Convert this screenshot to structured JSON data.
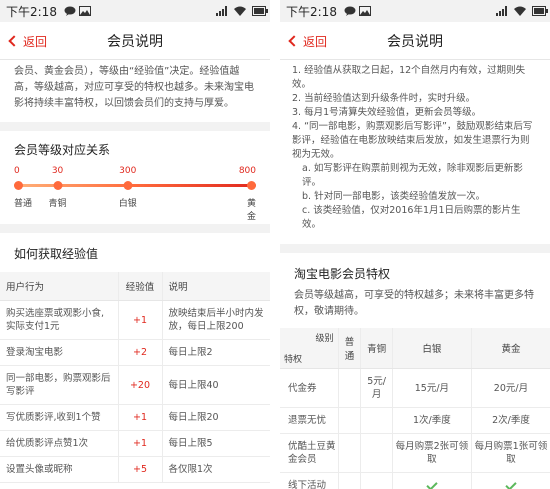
{
  "status": {
    "time": "下午2:18",
    "battery": ""
  },
  "nav": {
    "back_label": "返回",
    "title": "会员说明"
  },
  "left": {
    "intro": "会员、黄金会员），等级由“经验值”决定。经验值越高，等级越高，对应可享受的特权也越多。未来淘宝电影将持续丰富特权，以回馈会员们的支持与厚爱。",
    "levels_title": "会员等级对应关系",
    "levels": [
      {
        "value": "0",
        "name": "普通",
        "pos": 0
      },
      {
        "value": "30",
        "name": "青铜",
        "pos": 0.18
      },
      {
        "value": "300",
        "name": "白银",
        "pos": 0.47
      },
      {
        "value": "800",
        "name": "黄金",
        "pos": 1
      }
    ],
    "exp_title": "如何获取经验值",
    "exp_headers": [
      "用户行为",
      "经验值",
      "说明"
    ],
    "exp_rows": [
      {
        "action": "购买选座票或观影小食,实际支付1元",
        "value": "+1",
        "note": "放映结束后半小时内发放，每日上限200"
      },
      {
        "action": "登录淘宝电影",
        "value": "+2",
        "note": "每日上限2"
      },
      {
        "action": "同一部电影，购票观影后写影评",
        "value": "+20",
        "note": "每日上限40"
      },
      {
        "action": "写优质影评,收到1个赞",
        "value": "+1",
        "note": "每日上限20"
      },
      {
        "action": "给优质影评点赞1次",
        "value": "+1",
        "note": "每日上限5"
      },
      {
        "action": "设置头像或昵称",
        "value": "+5",
        "note": "各仅限1次"
      }
    ]
  },
  "right": {
    "rules": [
      "1. 经验值从获取之日起，12个自然月内有效，过期则失效。",
      "2. 当前经验值达到升级条件时，实时升级。",
      "3. 每月1号清算失效经验值，更新会员等级。",
      "4. “同一部电影，购票观影后写影评”，鼓励观影结束后写影评，经验值在电影放映结束后发放，如发生退票行为则视为无效。"
    ],
    "sub_rules": [
      "a. 如写影评在购票前则视为无效，除非观影后更新影评。",
      "b. 针对同一部电影，该类经验值发放一次。",
      "c. 该类经验值，仅对2016年1月1日后购票的影片生效。"
    ],
    "priv_title": "淘宝电影会员特权",
    "priv_desc": "会员等级越高，可享受的特权越多；未来将丰富更多特权，敬请期待。",
    "priv_corner_top": "级别",
    "priv_corner_bottom": "特权",
    "priv_headers": [
      "普通",
      "青铜",
      "白银",
      "黄金"
    ],
    "priv_rows": [
      {
        "name": "代金券",
        "cells": [
          "",
          "5元/月",
          "15元/月",
          "20元/月"
        ]
      },
      {
        "name": "退票无忧",
        "cells": [
          "",
          "",
          "1次/季度",
          "2次/季度"
        ]
      },
      {
        "name": "优酷土豆黄金会员",
        "cells": [
          "",
          "",
          "每月购票2张可领取",
          "每月购票1张可领取"
        ]
      },
      {
        "name": "线下活动",
        "cells": [
          "",
          "",
          "✓",
          "✓"
        ]
      }
    ]
  },
  "colors": {
    "accent": "#e0281e",
    "check": "#5cb85c"
  }
}
